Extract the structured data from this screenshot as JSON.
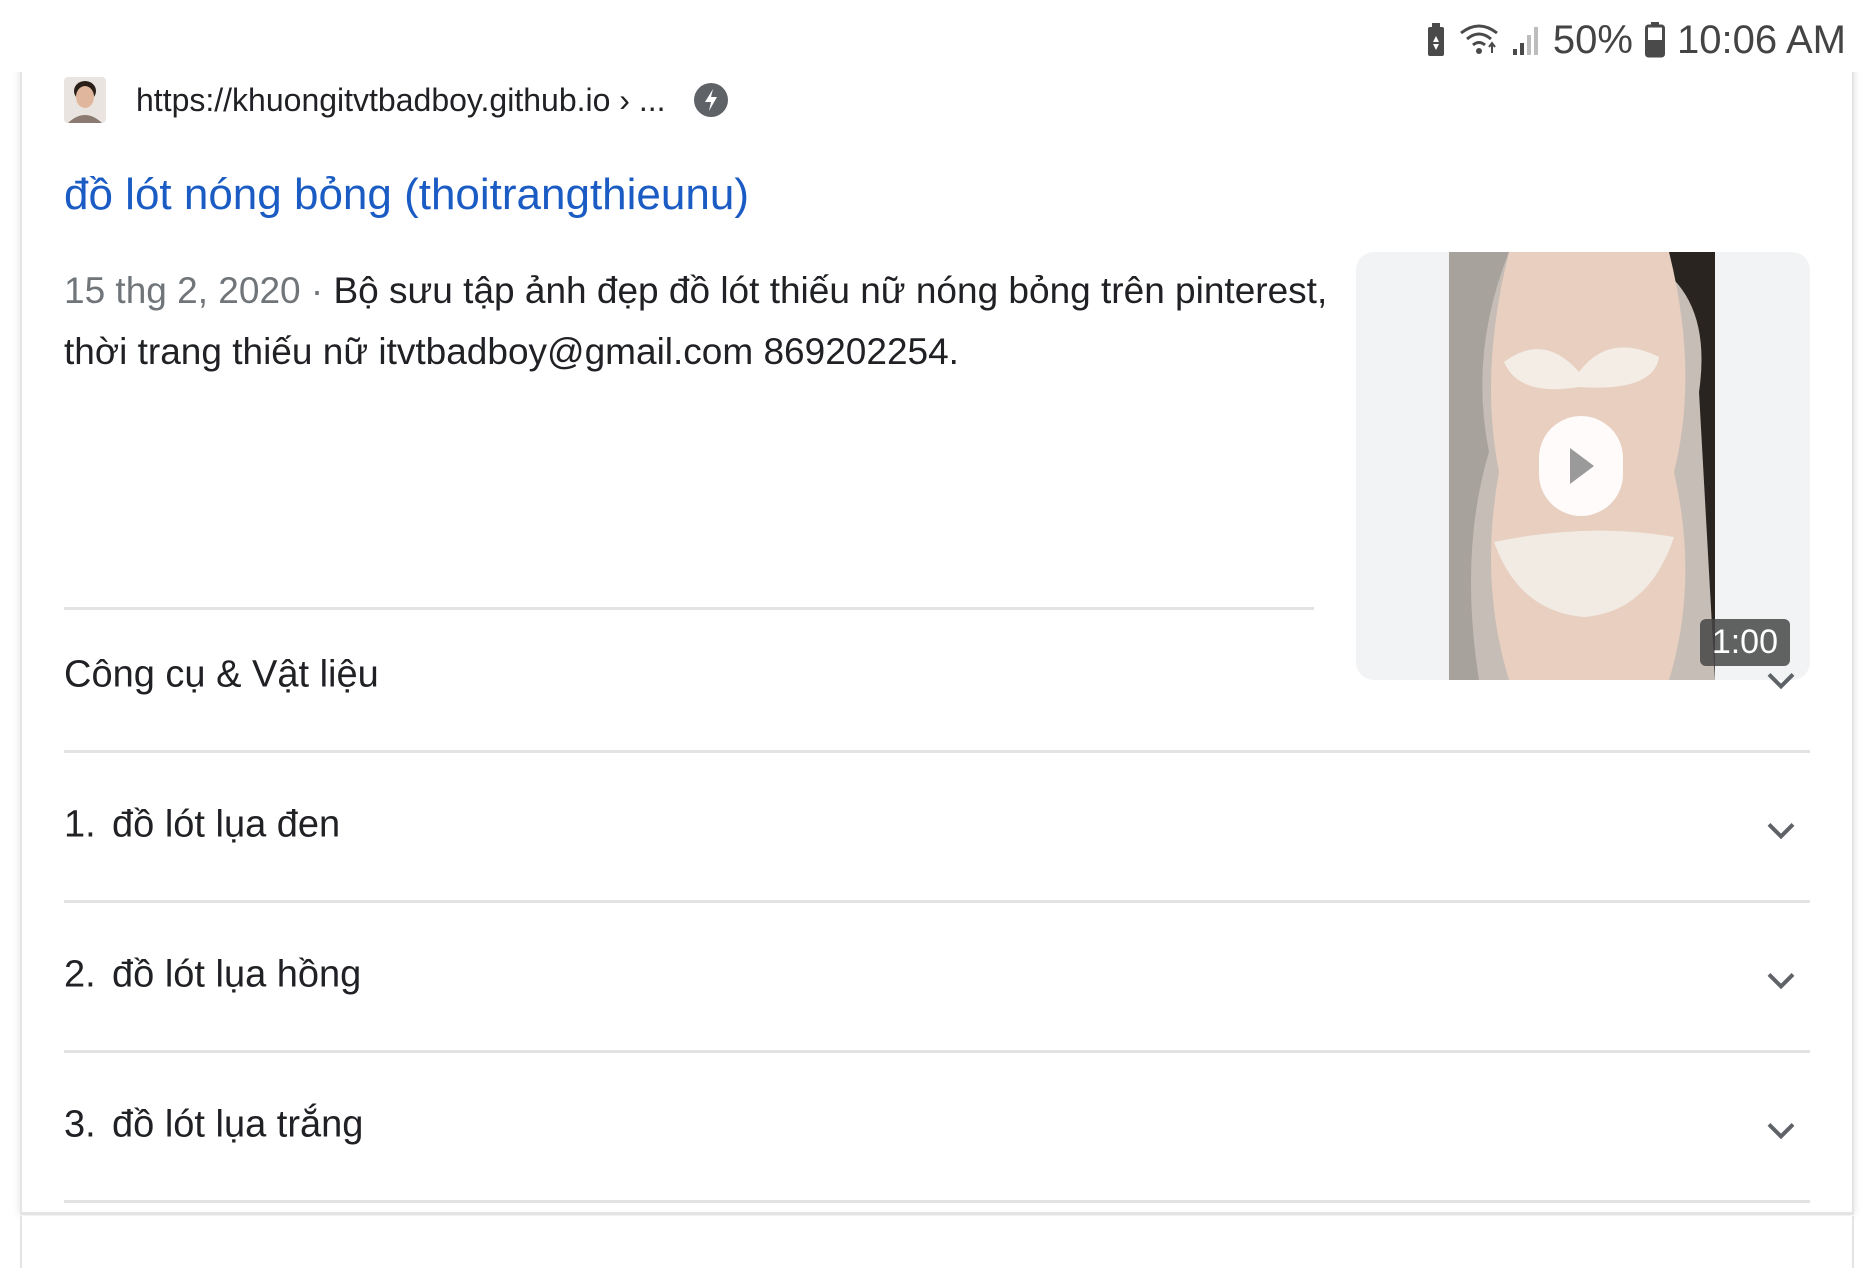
{
  "status_bar": {
    "battery_percent": "50%",
    "time": "10:06 AM",
    "icons": [
      "battery-saver-icon",
      "wifi-icon",
      "signal-icon",
      "battery-icon"
    ]
  },
  "result": {
    "favicon": "avatar-favicon",
    "source_url": "https://khuongitvtbadboy.github.io › ...",
    "amp_icon": "lightning-amp-icon",
    "title": "đồ lót nóng bỏng (thoitrangthieunu)",
    "snippet_date": "15 thg 2, 2020",
    "snippet_separator": " · ",
    "snippet_text": "Bộ sưu tập ảnh đẹp đồ lót thiếu nữ nóng bỏng trên pinterest, thời trang thiếu nữ itvtbadboy@gmail.com 869202254.",
    "video_duration": "1:00"
  },
  "accordion": [
    {
      "number": "",
      "label": "Công cụ & Vật liệu"
    },
    {
      "number": "1.",
      "label": "đồ lót lụa đen"
    },
    {
      "number": "2.",
      "label": "đồ lót lụa hồng"
    },
    {
      "number": "3.",
      "label": "đồ lót lụa trắng"
    }
  ],
  "colors": {
    "link": "#1a5bc4",
    "text": "#202124",
    "muted": "#70757a",
    "divider": "#e3e3e3"
  }
}
